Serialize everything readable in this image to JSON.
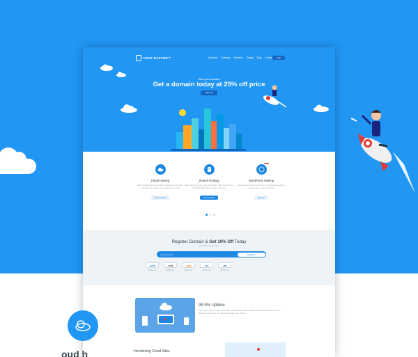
{
  "brand": {
    "name": "HOST RAPTOR™"
  },
  "nav": {
    "items": [
      "Domains",
      "Hostings",
      "Students",
      "Pages",
      "Blog",
      "Contact"
    ],
    "login_label": "Login"
  },
  "hero": {
    "kicker": "Start your business",
    "headline": "Get a domain today at 25% off price",
    "signup_label": "Sign Up"
  },
  "services": [
    {
      "title": "Cloud Hosting",
      "desc": "Hosts engage clients at domains, HomeHosts end clients. Get a lot more. Select at your Raptor & its proof",
      "button": "More Details",
      "primary": false,
      "icon": "cloud-icon"
    },
    {
      "title": "Shared Hosting",
      "desc": "Marks Hosting at your online brand login. Get it here with our cloud hosting for clients easily & business",
      "button": "View Details",
      "primary": true,
      "icon": "server-icon"
    },
    {
      "title": "WordPress Hosting",
      "desc": "Adequate cloud with your hosting. Our wordpress solution is a new & easy to apply this proof",
      "button": "Sign Up",
      "primary": false,
      "icon": "wordpress-icon",
      "badge": "NEW"
    }
  ],
  "domain": {
    "title_prefix": "Register Domain & ",
    "title_bold": "Get 10% Off",
    "title_suffix": " Today",
    "subtitle": "Let's find your domain",
    "placeholder": "search domain",
    "search_label": "SEARCH",
    "tlds": [
      {
        "name": ".com",
        "price": "$9.99 year"
      },
      {
        "name": ".net",
        "price": "$9.99 year"
      },
      {
        "name": ".org",
        "price": "$9.99 year"
      },
      {
        "name": ".au",
        "price": "$9.99 year"
      },
      {
        "name": ".eu",
        "price": "$9.99 year"
      }
    ]
  },
  "uptime": {
    "title": "99.9% Uptime",
    "desc": "Lorem ipsum dolor sit amet consectetur adipiscing elit. Vivamus sollicitudin lorem ipsum dolor amet elit aliquam tincidunt ante arcu pellentesque tellus non mauris."
  },
  "intro": {
    "title": "Introducing Cloud Sites"
  },
  "bottom": {
    "text": "oud h"
  },
  "colors": {
    "primary": "#2196f3",
    "dark": "#1565c0",
    "accent": "#f44336"
  }
}
